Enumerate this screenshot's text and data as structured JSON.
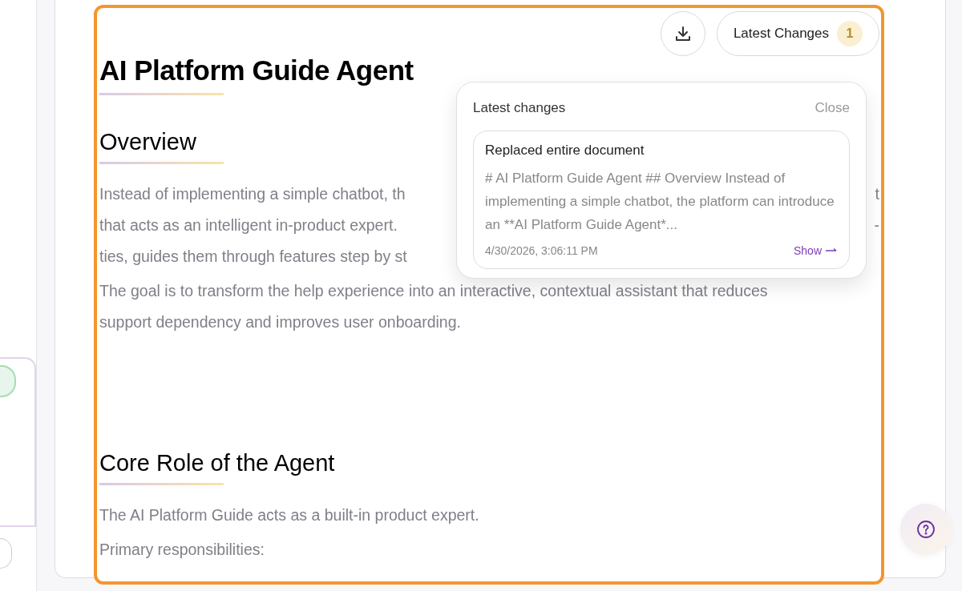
{
  "toolbar": {
    "latest_changes_button": {
      "label": "Latest Changes",
      "count": "1"
    }
  },
  "document": {
    "title": "AI Platform Guide Agent",
    "sections": [
      {
        "heading": "Overview",
        "paragraphs": [
          {
            "lines": [
              {
                "left": "Instead of implementing a simple chatbot, th",
                "right": "t"
              },
              {
                "left": "that acts as an intelligent in-product expert.",
                "right": "-"
              },
              {
                "left": "ties, guides them through features step by st"
              }
            ]
          },
          {
            "lines": [
              {
                "left": "The goal is to transform the help experience into an interactive, contextual assistant that reduces"
              },
              {
                "left": "support dependency and improves user onboarding."
              }
            ]
          }
        ]
      },
      {
        "heading": "Core Role of the Agent",
        "paragraphs": [
          {
            "lines": [
              {
                "left": "The AI Platform Guide acts as a built-in product expert."
              }
            ]
          },
          {
            "lines": [
              {
                "left": "Primary responsibilities:"
              }
            ]
          }
        ]
      }
    ]
  },
  "changes_popup": {
    "title": "Latest changes",
    "close": "Close",
    "entries": [
      {
        "title": "Replaced entire document",
        "preview": "# AI Platform Guide Agent ## Overview Instead of implementing a simple chatbot, the platform can introduce an **AI Platform Guide Agent*...",
        "time": "4/30/2026, 3:06:11 PM",
        "action": "Show"
      }
    ]
  }
}
